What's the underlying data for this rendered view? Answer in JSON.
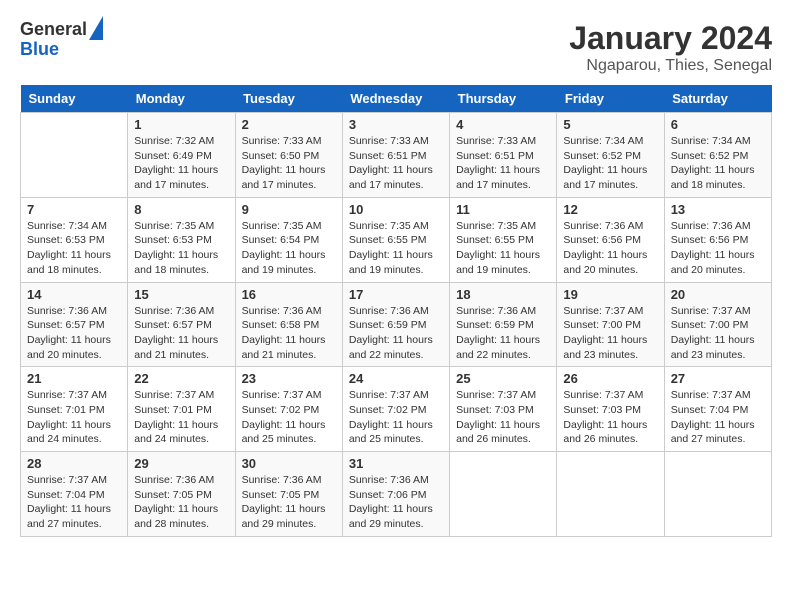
{
  "logo": {
    "line1": "General",
    "line2": "Blue"
  },
  "title": "January 2024",
  "subtitle": "Ngaparou, Thies, Senegal",
  "headers": [
    "Sunday",
    "Monday",
    "Tuesday",
    "Wednesday",
    "Thursday",
    "Friday",
    "Saturday"
  ],
  "weeks": [
    [
      {
        "day": "",
        "info": ""
      },
      {
        "day": "1",
        "info": "Sunrise: 7:32 AM\nSunset: 6:49 PM\nDaylight: 11 hours\nand 17 minutes."
      },
      {
        "day": "2",
        "info": "Sunrise: 7:33 AM\nSunset: 6:50 PM\nDaylight: 11 hours\nand 17 minutes."
      },
      {
        "day": "3",
        "info": "Sunrise: 7:33 AM\nSunset: 6:51 PM\nDaylight: 11 hours\nand 17 minutes."
      },
      {
        "day": "4",
        "info": "Sunrise: 7:33 AM\nSunset: 6:51 PM\nDaylight: 11 hours\nand 17 minutes."
      },
      {
        "day": "5",
        "info": "Sunrise: 7:34 AM\nSunset: 6:52 PM\nDaylight: 11 hours\nand 17 minutes."
      },
      {
        "day": "6",
        "info": "Sunrise: 7:34 AM\nSunset: 6:52 PM\nDaylight: 11 hours\nand 18 minutes."
      }
    ],
    [
      {
        "day": "7",
        "info": "Sunrise: 7:34 AM\nSunset: 6:53 PM\nDaylight: 11 hours\nand 18 minutes."
      },
      {
        "day": "8",
        "info": "Sunrise: 7:35 AM\nSunset: 6:53 PM\nDaylight: 11 hours\nand 18 minutes."
      },
      {
        "day": "9",
        "info": "Sunrise: 7:35 AM\nSunset: 6:54 PM\nDaylight: 11 hours\nand 19 minutes."
      },
      {
        "day": "10",
        "info": "Sunrise: 7:35 AM\nSunset: 6:55 PM\nDaylight: 11 hours\nand 19 minutes."
      },
      {
        "day": "11",
        "info": "Sunrise: 7:35 AM\nSunset: 6:55 PM\nDaylight: 11 hours\nand 19 minutes."
      },
      {
        "day": "12",
        "info": "Sunrise: 7:36 AM\nSunset: 6:56 PM\nDaylight: 11 hours\nand 20 minutes."
      },
      {
        "day": "13",
        "info": "Sunrise: 7:36 AM\nSunset: 6:56 PM\nDaylight: 11 hours\nand 20 minutes."
      }
    ],
    [
      {
        "day": "14",
        "info": "Sunrise: 7:36 AM\nSunset: 6:57 PM\nDaylight: 11 hours\nand 20 minutes."
      },
      {
        "day": "15",
        "info": "Sunrise: 7:36 AM\nSunset: 6:57 PM\nDaylight: 11 hours\nand 21 minutes."
      },
      {
        "day": "16",
        "info": "Sunrise: 7:36 AM\nSunset: 6:58 PM\nDaylight: 11 hours\nand 21 minutes."
      },
      {
        "day": "17",
        "info": "Sunrise: 7:36 AM\nSunset: 6:59 PM\nDaylight: 11 hours\nand 22 minutes."
      },
      {
        "day": "18",
        "info": "Sunrise: 7:36 AM\nSunset: 6:59 PM\nDaylight: 11 hours\nand 22 minutes."
      },
      {
        "day": "19",
        "info": "Sunrise: 7:37 AM\nSunset: 7:00 PM\nDaylight: 11 hours\nand 23 minutes."
      },
      {
        "day": "20",
        "info": "Sunrise: 7:37 AM\nSunset: 7:00 PM\nDaylight: 11 hours\nand 23 minutes."
      }
    ],
    [
      {
        "day": "21",
        "info": "Sunrise: 7:37 AM\nSunset: 7:01 PM\nDaylight: 11 hours\nand 24 minutes."
      },
      {
        "day": "22",
        "info": "Sunrise: 7:37 AM\nSunset: 7:01 PM\nDaylight: 11 hours\nand 24 minutes."
      },
      {
        "day": "23",
        "info": "Sunrise: 7:37 AM\nSunset: 7:02 PM\nDaylight: 11 hours\nand 25 minutes."
      },
      {
        "day": "24",
        "info": "Sunrise: 7:37 AM\nSunset: 7:02 PM\nDaylight: 11 hours\nand 25 minutes."
      },
      {
        "day": "25",
        "info": "Sunrise: 7:37 AM\nSunset: 7:03 PM\nDaylight: 11 hours\nand 26 minutes."
      },
      {
        "day": "26",
        "info": "Sunrise: 7:37 AM\nSunset: 7:03 PM\nDaylight: 11 hours\nand 26 minutes."
      },
      {
        "day": "27",
        "info": "Sunrise: 7:37 AM\nSunset: 7:04 PM\nDaylight: 11 hours\nand 27 minutes."
      }
    ],
    [
      {
        "day": "28",
        "info": "Sunrise: 7:37 AM\nSunset: 7:04 PM\nDaylight: 11 hours\nand 27 minutes."
      },
      {
        "day": "29",
        "info": "Sunrise: 7:36 AM\nSunset: 7:05 PM\nDaylight: 11 hours\nand 28 minutes."
      },
      {
        "day": "30",
        "info": "Sunrise: 7:36 AM\nSunset: 7:05 PM\nDaylight: 11 hours\nand 29 minutes."
      },
      {
        "day": "31",
        "info": "Sunrise: 7:36 AM\nSunset: 7:06 PM\nDaylight: 11 hours\nand 29 minutes."
      },
      {
        "day": "",
        "info": ""
      },
      {
        "day": "",
        "info": ""
      },
      {
        "day": "",
        "info": ""
      }
    ]
  ]
}
